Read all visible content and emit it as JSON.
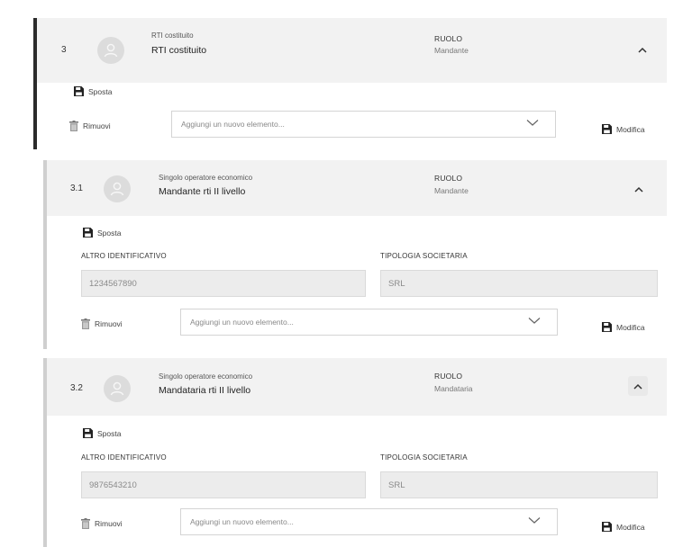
{
  "items": [
    {
      "number": "3",
      "type": "RTI costituito",
      "name": "RTI costituito",
      "role_label": "RUOLO",
      "role_value": "Mandante",
      "move_label": "Sposta",
      "remove_label": "Rimuovi",
      "add_placeholder": "Aggiungi un nuovo elemento...",
      "edit_label": "Modifica"
    },
    {
      "number": "3.1",
      "type": "Singolo operatore economico",
      "name": "Mandante rti II livello",
      "role_label": "RUOLO",
      "role_value": "Mandante",
      "move_label": "Sposta",
      "field1_label": "ALTRO IDENTIFICATIVO",
      "field1_value": "1234567890",
      "field2_label": "TIPOLOGIA SOCIETARIA",
      "field2_value": "SRL",
      "remove_label": "Rimuovi",
      "add_placeholder": "Aggiungi un nuovo elemento...",
      "edit_label": "Modifica"
    },
    {
      "number": "3.2",
      "type": "Singolo operatore economico",
      "name": "Mandataria rti II livello",
      "role_label": "RUOLO",
      "role_value": "Mandataria",
      "move_label": "Sposta",
      "field1_label": "ALTRO IDENTIFICATIVO",
      "field1_value": "9876543210",
      "field2_label": "TIPOLOGIA SOCIETARIA",
      "field2_value": "SRL",
      "remove_label": "Rimuovi",
      "add_placeholder": "Aggiungi un nuovo elemento...",
      "edit_label": "Modifica"
    }
  ],
  "colors": {
    "parent_bar": "#2b2b2b",
    "child_bar": "#cfcfcf",
    "header_bg": "#f2f2f2"
  },
  "icons": [
    "avatar-icon",
    "save-icon",
    "trash-icon",
    "chevron-up-icon",
    "chevron-down-icon"
  ]
}
